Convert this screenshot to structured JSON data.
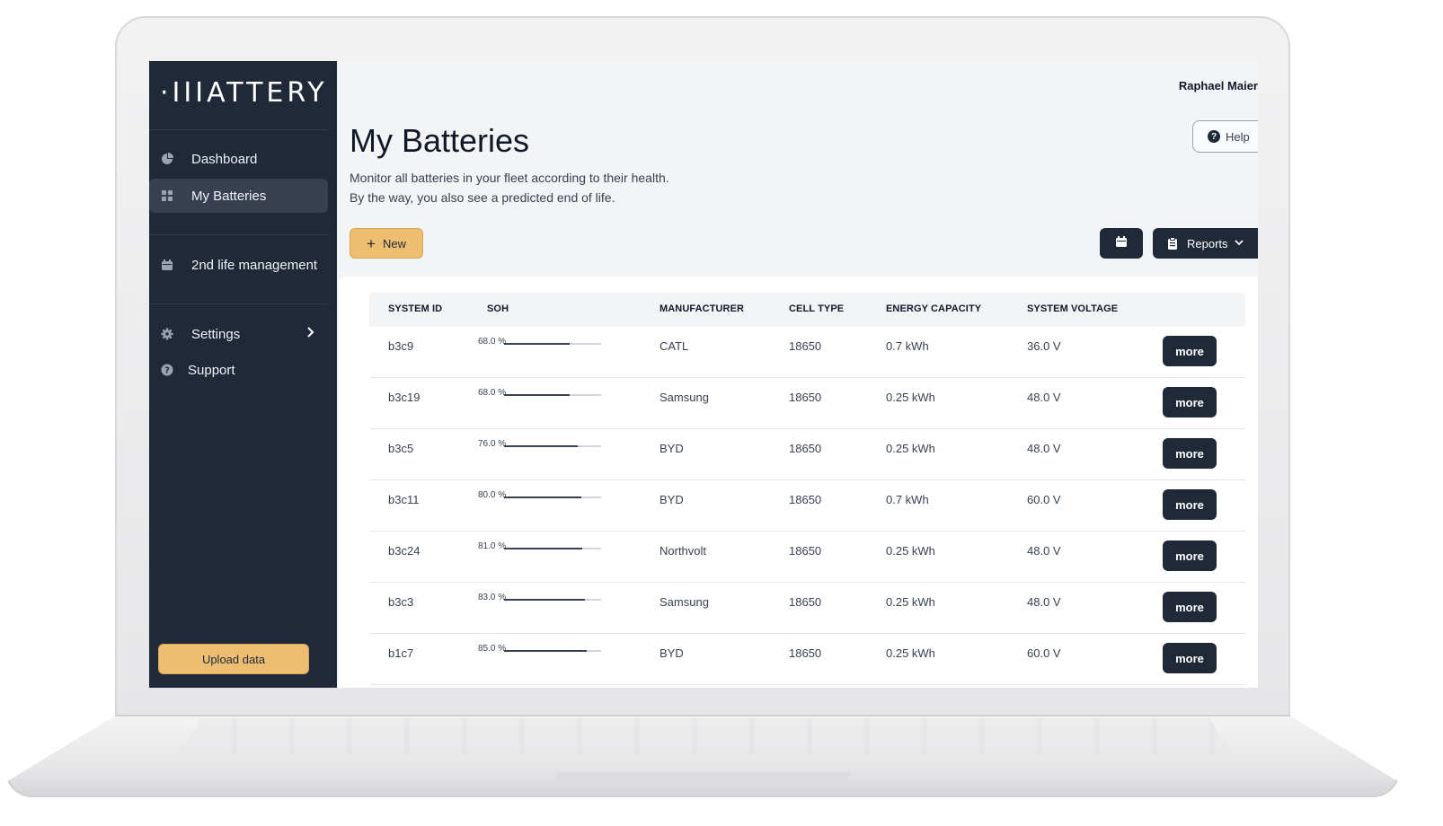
{
  "app": {
    "logo_text": "·IIIATTERY"
  },
  "sidebar": {
    "items": [
      {
        "label": "Dashboard",
        "icon": "pie-chart-icon",
        "active": false
      },
      {
        "label": "My Batteries",
        "icon": "grid-icon",
        "active": true
      },
      {
        "label": "2nd life management",
        "icon": "calendar-icon",
        "active": false
      },
      {
        "label": "Settings",
        "icon": "gear-icon",
        "active": false
      },
      {
        "label": "Support",
        "icon": "question-circle-icon",
        "active": false
      }
    ],
    "upload_label": "Upload data"
  },
  "header": {
    "user_name": "Raphael Maier",
    "help_label": "Help"
  },
  "page": {
    "title": "My Batteries",
    "subtitle_line1": "Monitor all batteries in your fleet according to their health.",
    "subtitle_line2": "By the way, you also see a predicted end of life."
  },
  "toolbar": {
    "new_label": "New",
    "reports_label": "Reports"
  },
  "table": {
    "columns": [
      "SYSTEM ID",
      "SOH",
      "MANUFACTURER",
      "CELL TYPE",
      "ENERGY CAPACITY",
      "SYSTEM VOLTAGE"
    ],
    "rows": [
      {
        "id": "b3c9",
        "soh": "68.0 %",
        "soh_fraction": 0.68,
        "manufacturer": "CATL",
        "cell": "18650",
        "capacity": "0.7 kWh",
        "voltage": "36.0 V",
        "action": "more"
      },
      {
        "id": "b3c19",
        "soh": "68.0 %",
        "soh_fraction": 0.68,
        "manufacturer": "Samsung",
        "cell": "18650",
        "capacity": "0.25 kWh",
        "voltage": "48.0 V",
        "action": "more"
      },
      {
        "id": "b3c5",
        "soh": "76.0 %",
        "soh_fraction": 0.76,
        "manufacturer": "BYD",
        "cell": "18650",
        "capacity": "0.25 kWh",
        "voltage": "48.0 V",
        "action": "more"
      },
      {
        "id": "b3c11",
        "soh": "80.0 %",
        "soh_fraction": 0.8,
        "manufacturer": "BYD",
        "cell": "18650",
        "capacity": "0.7 kWh",
        "voltage": "60.0 V",
        "action": "more"
      },
      {
        "id": "b3c24",
        "soh": "81.0 %",
        "soh_fraction": 0.81,
        "manufacturer": "Northvolt",
        "cell": "18650",
        "capacity": "0.25 kWh",
        "voltage": "48.0 V",
        "action": "more"
      },
      {
        "id": "b3c3",
        "soh": "83.0 %",
        "soh_fraction": 0.83,
        "manufacturer": "Samsung",
        "cell": "18650",
        "capacity": "0.25 kWh",
        "voltage": "48.0 V",
        "action": "more"
      },
      {
        "id": "b1c7",
        "soh": "85.0 %",
        "soh_fraction": 0.85,
        "manufacturer": "BYD",
        "cell": "18650",
        "capacity": "0.25 kWh",
        "voltage": "60.0 V",
        "action": "more"
      }
    ]
  },
  "colors": {
    "sidebar_bg": "#202938",
    "accent": "#edbd72",
    "dark_button": "#202938",
    "page_bg": "#f3f4f6"
  }
}
